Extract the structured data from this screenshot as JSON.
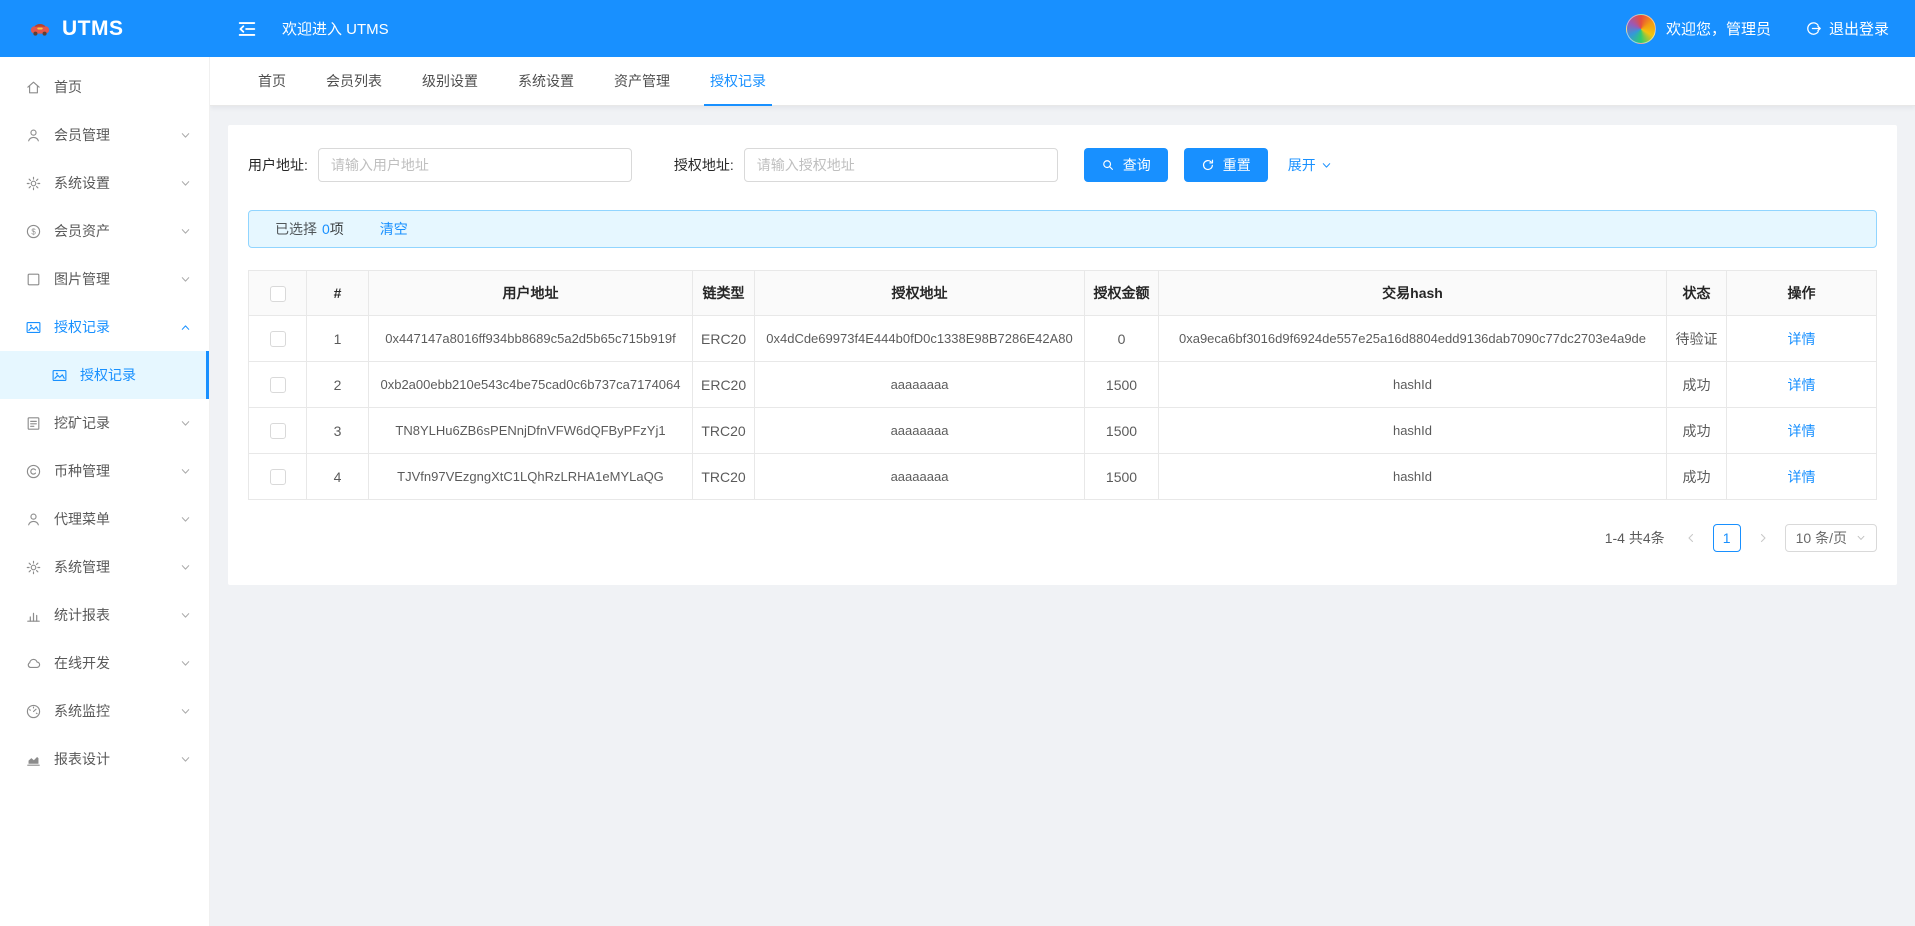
{
  "header": {
    "brand": "UTMS",
    "welcome": "欢迎进入 UTMS",
    "greeting": "欢迎您，管理员",
    "logout_label": "退出登录"
  },
  "sidebar": {
    "items": [
      {
        "label": "首页",
        "icon": "home-icon",
        "has_children": false
      },
      {
        "label": "会员管理",
        "icon": "user-icon",
        "has_children": true
      },
      {
        "label": "系统设置",
        "icon": "gear-icon",
        "has_children": true
      },
      {
        "label": "会员资产",
        "icon": "dollar-circle-icon",
        "has_children": true
      },
      {
        "label": "图片管理",
        "icon": "square-icon",
        "has_children": true
      },
      {
        "label": "授权记录",
        "icon": "picture-icon",
        "has_children": true,
        "expanded": true,
        "active": true,
        "children": [
          {
            "label": "授权记录",
            "icon": "picture-icon",
            "selected": true
          }
        ]
      },
      {
        "label": "挖矿记录",
        "icon": "file-icon",
        "has_children": true
      },
      {
        "label": "币种管理",
        "icon": "copyright-icon",
        "has_children": true
      },
      {
        "label": "代理菜单",
        "icon": "user-icon",
        "has_children": true
      },
      {
        "label": "系统管理",
        "icon": "gear-icon",
        "has_children": true
      },
      {
        "label": "统计报表",
        "icon": "bar-chart-icon",
        "has_children": true
      },
      {
        "label": "在线开发",
        "icon": "cloud-icon",
        "has_children": true
      },
      {
        "label": "系统监控",
        "icon": "gauge-icon",
        "has_children": true
      },
      {
        "label": "报表设计",
        "icon": "area-chart-icon",
        "has_children": true
      }
    ]
  },
  "tabs": {
    "items": [
      "首页",
      "会员列表",
      "级别设置",
      "系统设置",
      "资产管理",
      "授权记录"
    ],
    "active": "授权记录"
  },
  "filters": {
    "user_address": {
      "label": "用户地址:",
      "placeholder": "请输入用户地址",
      "value": ""
    },
    "auth_address": {
      "label": "授权地址:",
      "placeholder": "请输入授权地址",
      "value": ""
    },
    "search_button": "查询",
    "reset_button": "重置",
    "expand_link": "展开"
  },
  "selection": {
    "prefix": "已选择",
    "count": "0",
    "suffix": "项",
    "clear": "清空"
  },
  "table": {
    "columns": [
      "#",
      "用户地址",
      "链类型",
      "授权地址",
      "授权金额",
      "交易hash",
      "状态",
      "操作"
    ],
    "rows": [
      {
        "index": "1",
        "user_address": "0x447147a8016ff934bb8689c5a2d5b65c715b919f",
        "chain_type": "ERC20",
        "auth_address": "0x4dCde69973f4E444b0fD0c1338E98B7286E42A80",
        "amount": "0",
        "tx_hash": "0xa9eca6bf3016d9f6924de557e25a16d8804edd9136dab7090c77dc2703e4a9de",
        "status": "待验证",
        "action": "详情"
      },
      {
        "index": "2",
        "user_address": "0xb2a00ebb210e543c4be75cad0c6b737ca7174064",
        "chain_type": "ERC20",
        "auth_address": "aaaaaaaa",
        "amount": "1500",
        "tx_hash": "hashId",
        "status": "成功",
        "action": "详情"
      },
      {
        "index": "3",
        "user_address": "TN8YLHu6ZB6sPENnjDfnVFW6dQFByPFzYj1",
        "chain_type": "TRC20",
        "auth_address": "aaaaaaaa",
        "amount": "1500",
        "tx_hash": "hashId",
        "status": "成功",
        "action": "详情"
      },
      {
        "index": "4",
        "user_address": "TJVfn97VEzgngXtC1LQhRzLRHA1eMYLaQG",
        "chain_type": "TRC20",
        "auth_address": "aaaaaaaa",
        "amount": "1500",
        "tx_hash": "hashId",
        "status": "成功",
        "action": "详情"
      }
    ]
  },
  "pagination": {
    "total_text": "1-4 共4条",
    "current": "1",
    "page_size": "10 条/页"
  },
  "icons": {
    "brand-logo-icon": "car-shape",
    "menu-fold-icon": "≡",
    "avatar": "colorful-circle",
    "logout-icon": "⏻",
    "home-icon": "⌂",
    "user-icon": "👤",
    "gear-icon": "⚙",
    "dollar-circle-icon": "$",
    "square-icon": "□",
    "picture-icon": "🖼",
    "file-icon": "📄",
    "copyright-icon": "©",
    "bar-chart-icon": "📊",
    "cloud-icon": "☁",
    "gauge-icon": "⏱",
    "area-chart-icon": "📈",
    "chevron-down-icon": "∨",
    "chevron-up-icon": "∧",
    "search-icon": "🔍",
    "reload-icon": "⟳",
    "chevron-left-icon": "‹",
    "chevron-right-icon": "›"
  },
  "colors": {
    "primary": "#1890ff",
    "selection_bg": "#e6f7ff",
    "selection_border": "#91d5ff",
    "content_bg": "#f0f2f5"
  }
}
